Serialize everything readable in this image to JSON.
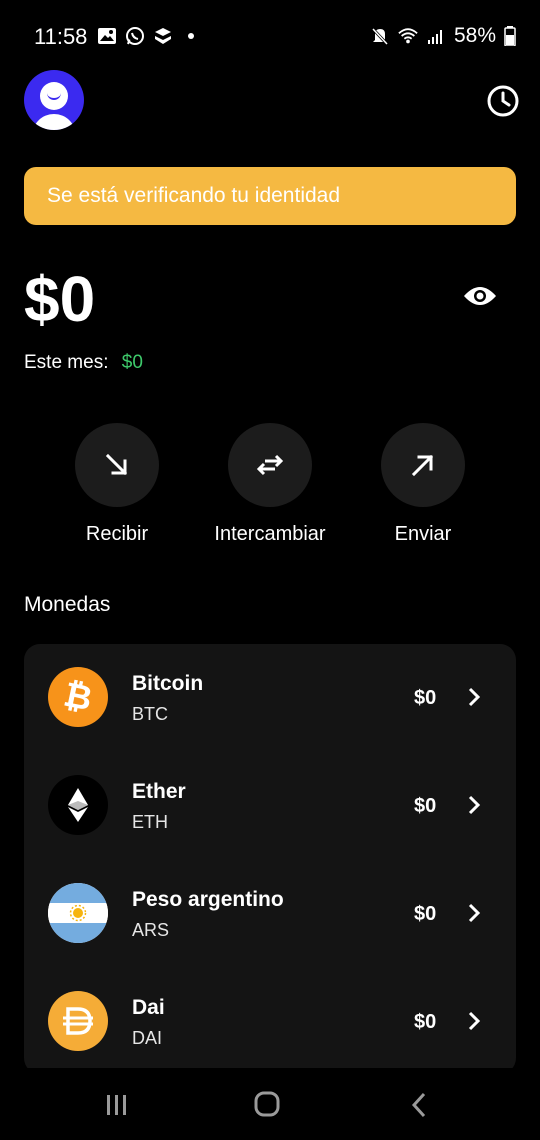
{
  "status_bar": {
    "time": "11:58",
    "battery": "58%"
  },
  "header": {
    "avatar_icon": "user-avatar",
    "history_icon": "clock-icon"
  },
  "banner": {
    "text": "Se está verificando tu identidad",
    "color": "#f5b942"
  },
  "balance": {
    "amount": "$0",
    "month_label": "Este mes:",
    "month_value": "$0",
    "month_value_color": "#3ec96b"
  },
  "actions": [
    {
      "label": "Recibir",
      "icon": "arrow-down-right-icon"
    },
    {
      "label": "Intercambiar",
      "icon": "swap-icon"
    },
    {
      "label": "Enviar",
      "icon": "arrow-up-right-icon"
    }
  ],
  "coins": {
    "title": "Monedas",
    "items": [
      {
        "name": "Bitcoin",
        "symbol": "BTC",
        "value": "$0",
        "icon": "bitcoin-icon",
        "color": "#f7931a"
      },
      {
        "name": "Ether",
        "symbol": "ETH",
        "value": "$0",
        "icon": "ethereum-icon",
        "color": "#000000"
      },
      {
        "name": "Peso argentino",
        "symbol": "ARS",
        "value": "$0",
        "icon": "argentina-flag-icon",
        "color": "#74acdf"
      },
      {
        "name": "Dai",
        "symbol": "DAI",
        "value": "$0",
        "icon": "dai-icon",
        "color": "#f5ac37"
      }
    ]
  }
}
